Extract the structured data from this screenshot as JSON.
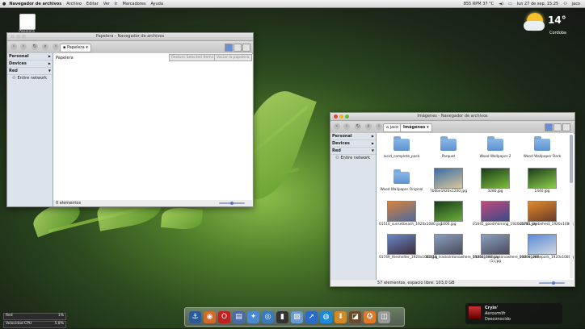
{
  "menubar": {
    "apple": "",
    "app": "Navegador de archivos",
    "menus": [
      "Archivo",
      "Editar",
      "Ver",
      "Ir",
      "Marcadores",
      "Ayuda"
    ],
    "status": "855 RPM 37 °C",
    "clock": "lun 27 de sep, 15:25",
    "user": "jaco"
  },
  "desktop": {
    "trash_label": "Papelera"
  },
  "weather": {
    "temp": "14°",
    "city": "Cordoba"
  },
  "win_trash": {
    "title": "Papelera - Navegador de archivos",
    "crumb": "Papelera",
    "sidebar": [
      {
        "label": "Personal",
        "arrow": "▶"
      },
      {
        "label": "Devices",
        "arrow": "▶"
      },
      {
        "label": "Red",
        "arrow": "▼"
      }
    ],
    "network_item": "Entire network",
    "location_label": "Papelera",
    "restore_btn": "Restore Selected Items",
    "empty_btn": "Vaciar la papelera",
    "status": "0 elementos"
  },
  "win_images": {
    "title": "Imágenes - Navegador de archivos",
    "crumb_parent": "jaco",
    "crumb_current": "Imágenes",
    "sidebar": [
      {
        "label": "Personal",
        "arrow": "▶"
      },
      {
        "label": "Devices",
        "arrow": "▶"
      },
      {
        "label": "Red",
        "arrow": "▼"
      }
    ],
    "network_item": "Entire network",
    "items": [
      {
        "name": "lucid_complete_pack",
        "kind": "folder"
      },
      {
        "name": "Parquet",
        "kind": "folder"
      },
      {
        "name": "Wood Wallpaper 2",
        "kind": "folder"
      },
      {
        "name": "Wood Wallpaper Dark",
        "kind": "folder"
      },
      {
        "name": "Wood Wallpaper Original",
        "kind": "folder"
      },
      {
        "name": "7b6be1920x1200.jpg",
        "kind": "image",
        "c1": "#3a6ea8",
        "c2": "#d9c69a"
      },
      {
        "name": "3280.jpg",
        "kind": "image",
        "c1": "#1b3a1b",
        "c2": "#7cbf3c"
      },
      {
        "name": "1440.jpg",
        "kind": "image",
        "c1": "#1b3a1b",
        "c2": "#8cd04a"
      },
      {
        "name": "01510_sunsetbeach_1920x1080.jpg",
        "kind": "image",
        "c1": "#d8823a",
        "c2": "#4a6aa0"
      },
      {
        "name": "1600.jpg",
        "kind": "image",
        "c1": "#1b3a1b",
        "c2": "#6ab03a"
      },
      {
        "name": "01645_goodmorning_1920x1080.jpg",
        "kind": "image",
        "c1": "#c04a7a",
        "c2": "#3a4a8a"
      },
      {
        "name": "01721_thebehest_1920x1080.jpg",
        "kind": "image",
        "c1": "#e08a2a",
        "c2": "#6a3a2a"
      },
      {
        "name": "01749_theshelter_1920x1080.jpg",
        "kind": "image",
        "c1": "#6a8ac8",
        "c2": "#3a2a3a"
      },
      {
        "name": "01816_tracksintonowhere_1920x1080.jpg",
        "kind": "image",
        "c1": "#8aa0c0",
        "c2": "#4a4a5a"
      },
      {
        "name": "01816_tracksintonowhere_1920x1080 (1).jpg",
        "kind": "image",
        "c1": "#8aa0c0",
        "c2": "#4a4a5a"
      },
      {
        "name": "01899_atthepark_1920x1080.jpg",
        "kind": "image",
        "c1": "#5a8ad8",
        "c2": "#d0d8e0"
      }
    ],
    "status": "57 elementos, espacio libre: 103,0 GB"
  },
  "dock": [
    {
      "name": "anchor-icon",
      "glyph": "⚓",
      "color": "#2a5a9a"
    },
    {
      "name": "finder-icon",
      "glyph": "◉",
      "color": "#d06a2a"
    },
    {
      "name": "opera-icon",
      "glyph": "O",
      "color": "#c02020"
    },
    {
      "name": "document-icon",
      "glyph": "▤",
      "color": "#4a6aa8"
    },
    {
      "name": "bird-icon",
      "glyph": "✦",
      "color": "#4a8ad0"
    },
    {
      "name": "globe-icon",
      "glyph": "◎",
      "color": "#3a7ab8"
    },
    {
      "name": "terminal-icon",
      "glyph": "▮",
      "color": "#333333"
    },
    {
      "name": "preview-icon",
      "glyph": "▧",
      "color": "#6a9ad0"
    },
    {
      "name": "cursor-icon",
      "glyph": "➚",
      "color": "#2a6ac8"
    },
    {
      "name": "network-icon",
      "glyph": "◍",
      "color": "#1a8ad8"
    },
    {
      "name": "download-icon",
      "glyph": "⬇",
      "color": "#d08a2a"
    },
    {
      "name": "monitor-icon",
      "glyph": "◪",
      "color": "#6a4a2a"
    },
    {
      "name": "safari-icon",
      "glyph": "✪",
      "color": "#e07a2a"
    },
    {
      "name": "trash-icon",
      "glyph": "◫",
      "color": "#9a9a9a"
    }
  ],
  "sysmon": [
    {
      "label": "Red",
      "value": "1%"
    },
    {
      "label": "Velocidad CPU",
      "value": "5.8%"
    }
  ],
  "notification": {
    "title": "Cryin'",
    "artist": "Aerosmith",
    "album": "Desconocido"
  }
}
